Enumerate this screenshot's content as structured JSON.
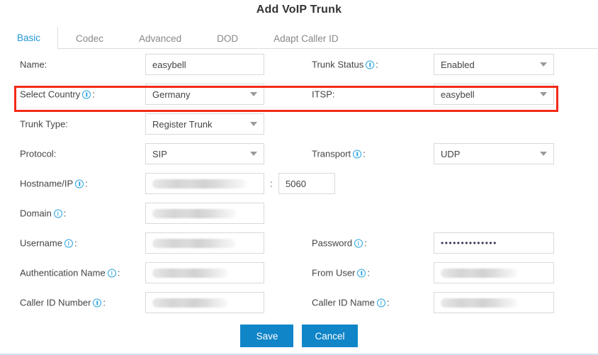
{
  "dialog": {
    "title": "Add VoIP Trunk"
  },
  "tabs": [
    {
      "label": "Basic",
      "active": true
    },
    {
      "label": "Codec",
      "active": false
    },
    {
      "label": "Advanced",
      "active": false
    },
    {
      "label": "DOD",
      "active": false
    },
    {
      "label": "Adapt Caller ID",
      "active": false
    }
  ],
  "form": {
    "name": {
      "label": "Name:",
      "value": "easybell"
    },
    "trunk_status": {
      "label": "Trunk Status",
      "suffix": ":",
      "value": "Enabled"
    },
    "select_country": {
      "label": "Select Country",
      "suffix": ":",
      "value": "Germany"
    },
    "itsp": {
      "label": "ITSP:",
      "value": "easybell"
    },
    "trunk_type": {
      "label": "Trunk Type:",
      "value": "Register Trunk"
    },
    "protocol": {
      "label": "Protocol:",
      "value": "SIP"
    },
    "transport": {
      "label": "Transport",
      "suffix": ":",
      "value": "UDP"
    },
    "hostname_ip": {
      "label": "Hostname/IP",
      "suffix": ":",
      "value": "",
      "masked": true,
      "separator": ":"
    },
    "port": {
      "value": "5060"
    },
    "domain": {
      "label": "Domain",
      "suffix": ":",
      "value": "",
      "masked": true
    },
    "username": {
      "label": "Username",
      "suffix": ":",
      "value": "",
      "masked": true
    },
    "password": {
      "label": "Password",
      "suffix": ":",
      "value": "••••••••••••••"
    },
    "authentication_name": {
      "label": "Authentication Name",
      "suffix": ":",
      "value": "",
      "masked": true
    },
    "from_user": {
      "label": "From User",
      "suffix": ":",
      "value": "",
      "masked": true
    },
    "caller_id_number": {
      "label": "Caller ID Number",
      "suffix": ":",
      "value": "",
      "masked": true
    },
    "caller_id_name": {
      "label": "Caller ID Name",
      "suffix": ":",
      "value": "",
      "masked": true
    }
  },
  "footer": {
    "save_label": "Save",
    "cancel_label": "Cancel"
  },
  "icons": {
    "info": "info-icon",
    "chevron_down": "chevron-down-icon"
  },
  "colors": {
    "accent": "#1085c8",
    "active_tab_text": "#2196d4",
    "info_icon": "#29a3e0",
    "highlight_border": "#f42a18",
    "field_border": "#d9d9d9",
    "text": "#444444"
  }
}
